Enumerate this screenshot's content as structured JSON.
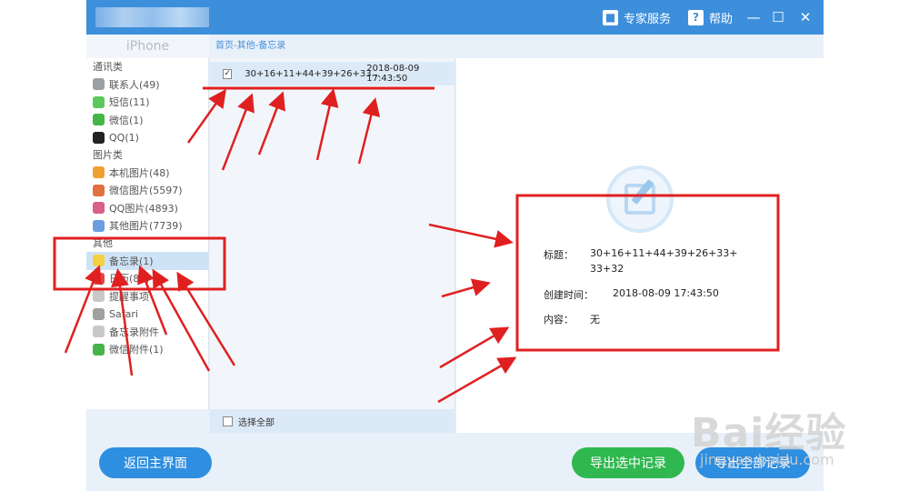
{
  "titlebar": {
    "expert_service_label": "专家服务",
    "help_label": "帮助",
    "minimize_glyph": "—",
    "maximize_glyph": "☐",
    "close_glyph": "✕"
  },
  "device_tab": {
    "label": "iPhone"
  },
  "breadcrumb": "首页-其他-备忘录",
  "sidebar": {
    "groups": [
      {
        "label": "通讯类",
        "items": [
          {
            "label": "联系人(49)",
            "icon": "contacts-icon",
            "color": "#9aa0a6"
          },
          {
            "label": "短信(11)",
            "icon": "sms-icon",
            "color": "#5cc85c"
          },
          {
            "label": "微信(1)",
            "icon": "wechat-icon",
            "color": "#45b549"
          },
          {
            "label": "QQ(1)",
            "icon": "qq-icon",
            "color": "#222222"
          }
        ]
      },
      {
        "label": "图片类",
        "items": [
          {
            "label": "本机图片(48)",
            "icon": "photos-icon",
            "color": "#f0a030"
          },
          {
            "label": "微信图片(5597)",
            "icon": "wechat-photos-icon",
            "color": "#e07040"
          },
          {
            "label": "QQ图片(4893)",
            "icon": "qq-photos-icon",
            "color": "#d8608a"
          },
          {
            "label": "其他图片(7739)",
            "icon": "other-photos-icon",
            "color": "#6a9ee0"
          }
        ]
      },
      {
        "label": "其他",
        "items": [
          {
            "label": "备忘录(1)",
            "icon": "notes-icon",
            "color": "#f5d040",
            "selected": true
          },
          {
            "label": "日历(89)",
            "icon": "calendar-icon",
            "color": "#e04848"
          },
          {
            "label": "提醒事项",
            "icon": "reminders-icon",
            "color": "#c8c8c8"
          },
          {
            "label": "Safari",
            "icon": "safari-icon",
            "color": "#a0a0a0"
          },
          {
            "label": "备忘录附件",
            "icon": "notes-attachment-icon",
            "color": "#c8c8c8"
          },
          {
            "label": "微信附件(1)",
            "icon": "wechat-attachment-icon",
            "color": "#45b549"
          }
        ]
      }
    ]
  },
  "list": {
    "rows": [
      {
        "checked": true,
        "check_glyph": "✓",
        "title": "30+16+11+44+39+26+33...",
        "time": "2018-08-09 17:43:50"
      }
    ],
    "select_all_label": "选择全部"
  },
  "detail": {
    "title_label": "标题：",
    "title_value_line1": "30+16+11+44+39+26+33+",
    "title_value_line2": "33+32",
    "created_label": "创建时间：",
    "created_value": "2018-08-09 17:43:50",
    "content_label": "内容：",
    "content_value": "无"
  },
  "buttons": {
    "back_main": "返回主界面",
    "export_selected": "导出选中记录",
    "export_all": "导出全部记录"
  },
  "watermark": {
    "brand": "Bai经验",
    "url": "jingyan.baidu.com"
  },
  "colors": {
    "titlebar": "#3d8fdc",
    "accent_blue": "#2e8ee0",
    "green": "#2fb84f",
    "annotation_red": "#e02020"
  }
}
